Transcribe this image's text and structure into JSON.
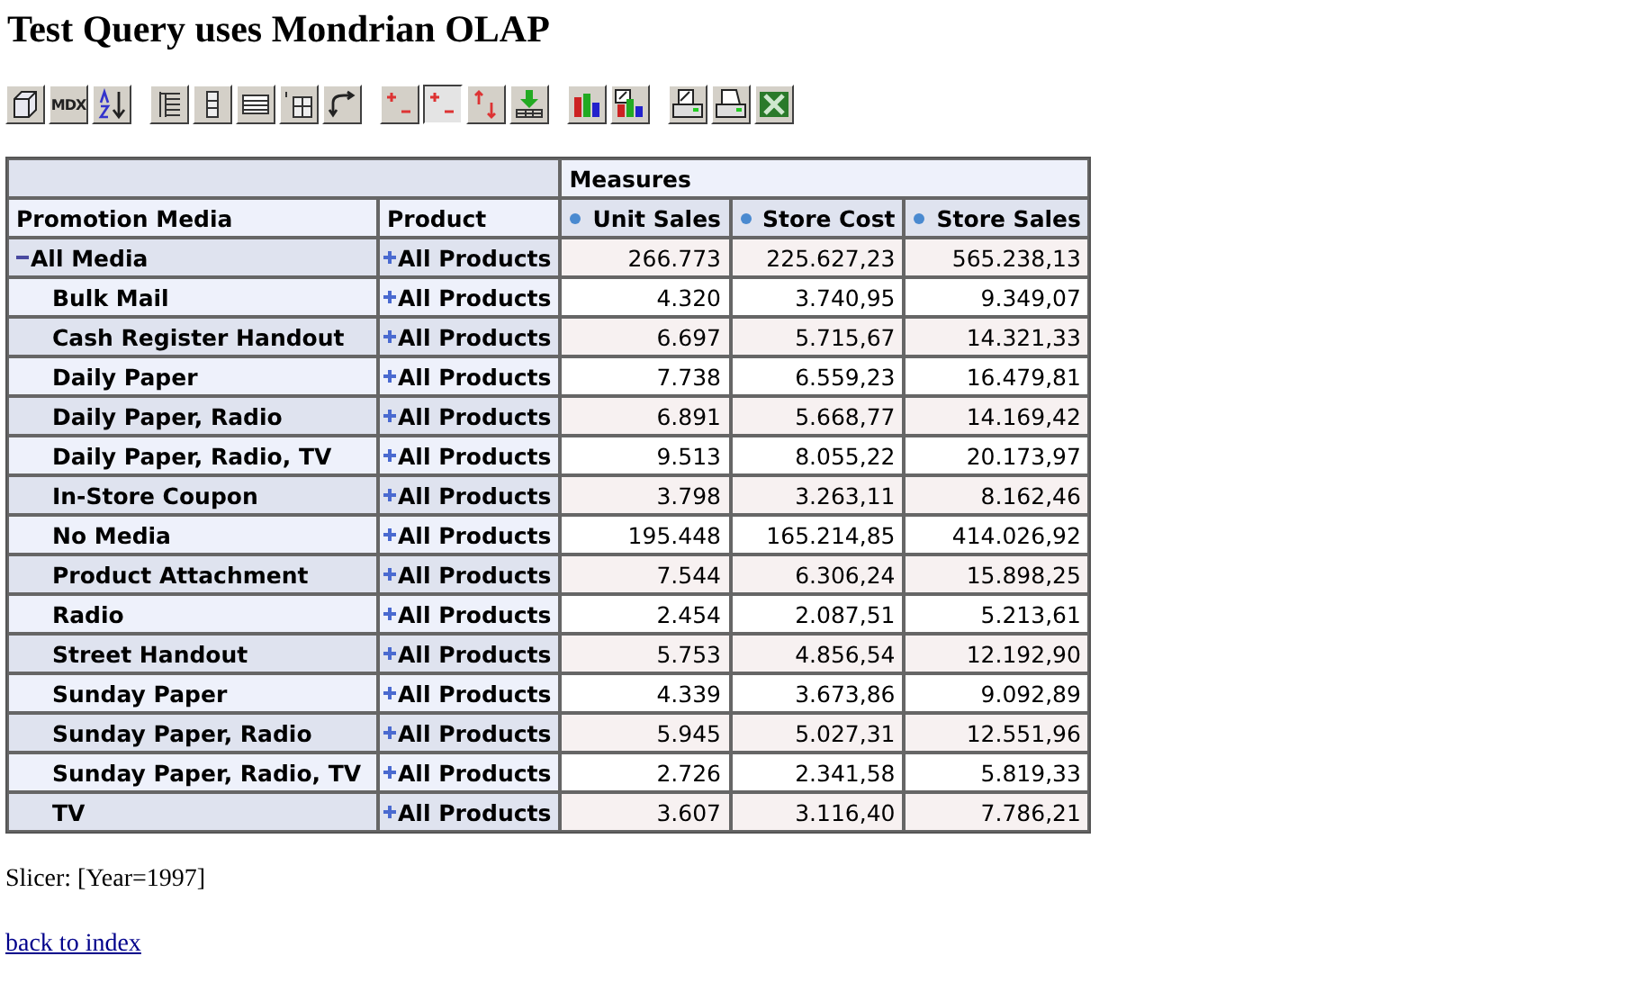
{
  "title": "Test Query uses Mondrian OLAP",
  "toolbar": [
    [
      {
        "kind": "cube",
        "pressed": false
      },
      {
        "kind": "mdx",
        "label": "MDX",
        "pressed": false
      },
      {
        "kind": "sort",
        "pressed": false
      }
    ],
    [
      {
        "kind": "hierarchy",
        "pressed": false
      },
      {
        "kind": "columns",
        "pressed": false
      },
      {
        "kind": "table",
        "pressed": false
      },
      {
        "kind": "zero-grid",
        "pressed": false
      },
      {
        "kind": "swap",
        "pressed": false
      }
    ],
    [
      {
        "kind": "expand-collapse",
        "pressed": false
      },
      {
        "kind": "expand-collapse",
        "pressed": true
      },
      {
        "kind": "up-down",
        "pressed": false
      },
      {
        "kind": "drill",
        "pressed": false
      }
    ],
    [
      {
        "kind": "chart",
        "pressed": false
      },
      {
        "kind": "chart-edit",
        "pressed": false
      }
    ],
    [
      {
        "kind": "print-setup",
        "pressed": false
      },
      {
        "kind": "print",
        "pressed": false
      },
      {
        "kind": "excel",
        "pressed": false
      }
    ]
  ],
  "table": {
    "column_group": "Measures",
    "row_headings": [
      "Promotion Media",
      "Product"
    ],
    "measures": [
      "Unit Sales",
      "Store Cost",
      "Store Sales"
    ],
    "rows": [
      {
        "media": "All Media",
        "expanded": true,
        "product": "All Products",
        "values": [
          "266.773",
          "225.627,23",
          "565.238,13"
        ],
        "children": [
          {
            "media": "Bulk Mail",
            "product": "All Products",
            "values": [
              "4.320",
              "3.740,95",
              "9.349,07"
            ]
          },
          {
            "media": "Cash Register Handout",
            "product": "All Products",
            "values": [
              "6.697",
              "5.715,67",
              "14.321,33"
            ]
          },
          {
            "media": "Daily Paper",
            "product": "All Products",
            "values": [
              "7.738",
              "6.559,23",
              "16.479,81"
            ]
          },
          {
            "media": "Daily Paper, Radio",
            "product": "All Products",
            "values": [
              "6.891",
              "5.668,77",
              "14.169,42"
            ]
          },
          {
            "media": "Daily Paper, Radio, TV",
            "product": "All Products",
            "values": [
              "9.513",
              "8.055,22",
              "20.173,97"
            ]
          },
          {
            "media": "In-Store Coupon",
            "product": "All Products",
            "values": [
              "3.798",
              "3.263,11",
              "8.162,46"
            ]
          },
          {
            "media": "No Media",
            "product": "All Products",
            "values": [
              "195.448",
              "165.214,85",
              "414.026,92"
            ]
          },
          {
            "media": "Product Attachment",
            "product": "All Products",
            "values": [
              "7.544",
              "6.306,24",
              "15.898,25"
            ]
          },
          {
            "media": "Radio",
            "product": "All Products",
            "values": [
              "2.454",
              "2.087,51",
              "5.213,61"
            ]
          },
          {
            "media": "Street Handout",
            "product": "All Products",
            "values": [
              "5.753",
              "4.856,54",
              "12.192,90"
            ]
          },
          {
            "media": "Sunday Paper",
            "product": "All Products",
            "values": [
              "4.339",
              "3.673,86",
              "9.092,89"
            ]
          },
          {
            "media": "Sunday Paper, Radio",
            "product": "All Products",
            "values": [
              "5.945",
              "5.027,31",
              "12.551,96"
            ]
          },
          {
            "media": "Sunday Paper, Radio, TV",
            "product": "All Products",
            "values": [
              "2.726",
              "2.341,58",
              "5.819,33"
            ]
          },
          {
            "media": "TV",
            "product": "All Products",
            "values": [
              "3.607",
              "3.116,40",
              "7.786,21"
            ]
          }
        ]
      }
    ]
  },
  "slicer": "Slicer: [Year=1997]",
  "link": "back to index"
}
